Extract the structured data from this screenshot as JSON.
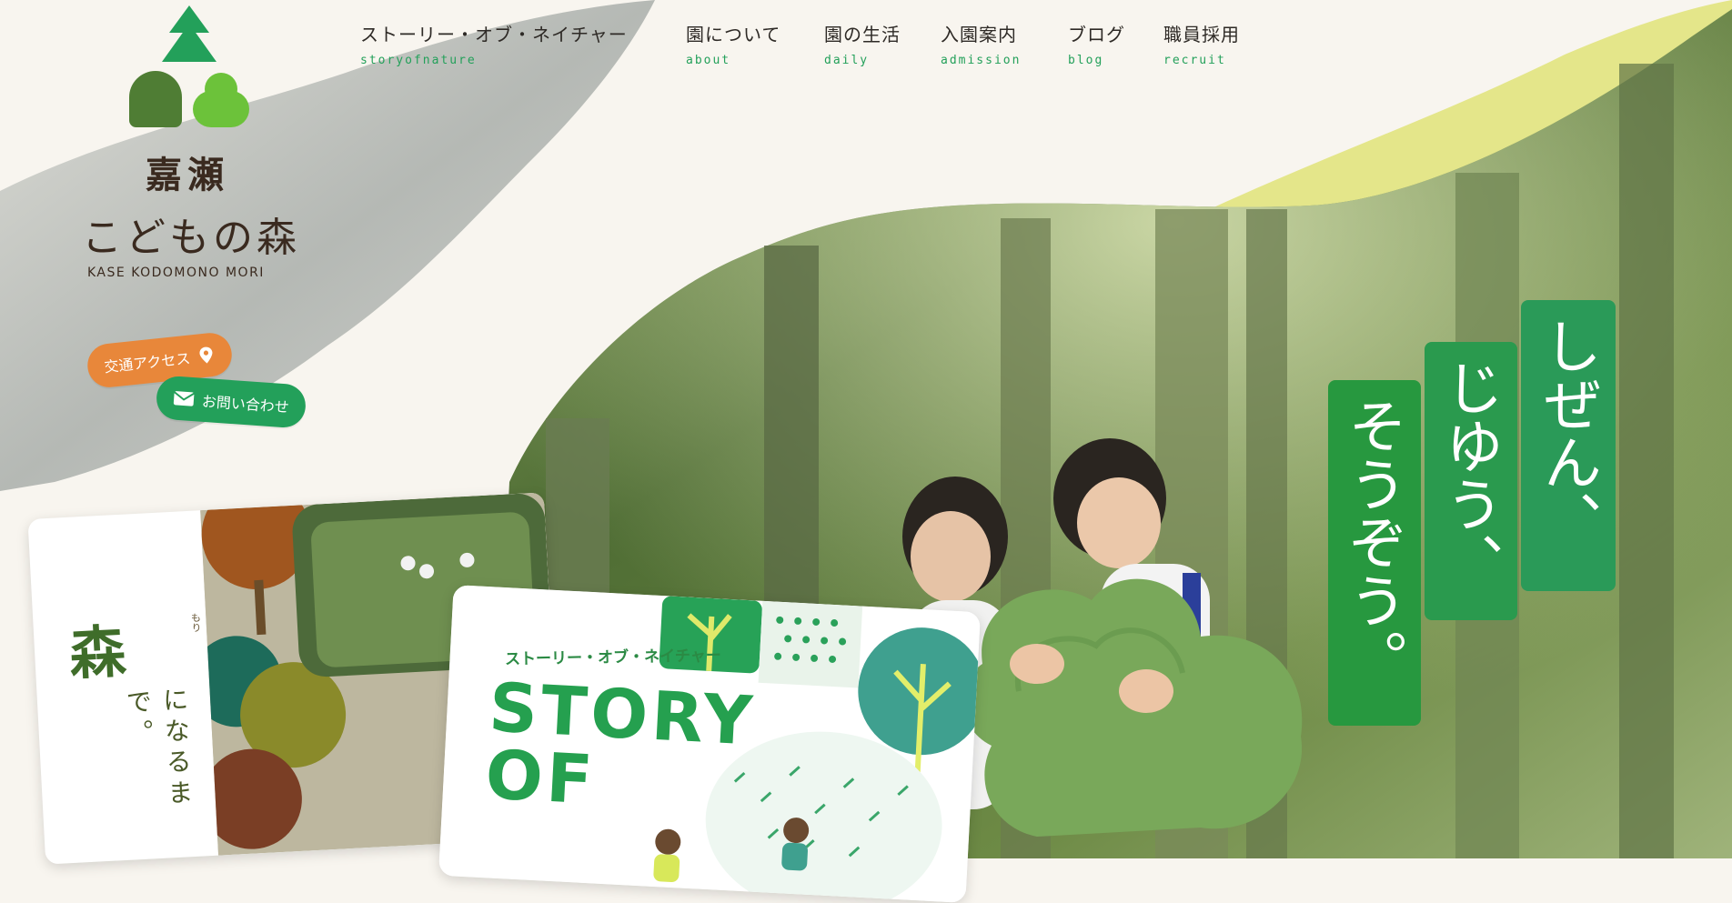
{
  "site": {
    "logo_kanji": "嘉瀬",
    "logo_kana": "こどもの森",
    "logo_roman": "KASE KODOMONO MORI"
  },
  "nav": [
    {
      "jp": "ストーリー・オブ・ネイチャー",
      "en": "storyofnature"
    },
    {
      "jp": "園について",
      "en": "about"
    },
    {
      "jp": "園の生活",
      "en": "daily"
    },
    {
      "jp": "入園案内",
      "en": "admission"
    },
    {
      "jp": "ブログ",
      "en": "blog"
    },
    {
      "jp": "職員採用",
      "en": "recruit"
    }
  ],
  "buttons": {
    "access": "交通アクセス",
    "contact": "お問い合わせ"
  },
  "tagline": [
    "しぜん、",
    "じゆう、",
    "そうぞう。"
  ],
  "cards": {
    "mori": {
      "title": "森",
      "ruby": "もり",
      "text": "になるまで。"
    },
    "story": {
      "jp": "ストーリー・オブ・ネイチャー",
      "line1": "STORY",
      "line2": "OF"
    }
  },
  "colors": {
    "brand_green": "#23a05a",
    "accent_orange": "#e8873a",
    "dark_green": "#4f7d34",
    "lime": "#e8e98a"
  },
  "icons": [
    "tree-icon",
    "map-pin-icon",
    "mail-icon"
  ]
}
